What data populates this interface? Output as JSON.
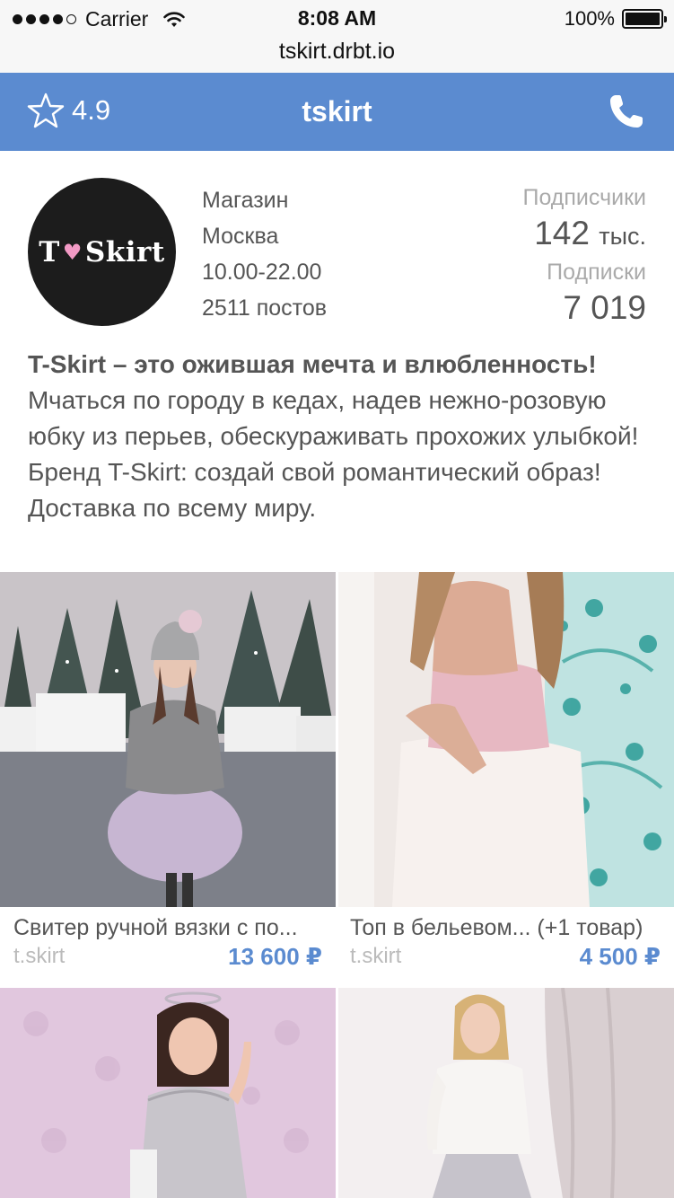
{
  "status": {
    "carrier": "Carrier",
    "time": "8:08 AM",
    "battery": "100%"
  },
  "browser": {
    "url": "tskirt.drbt.io"
  },
  "nav": {
    "rating": "4.9",
    "title": "tskirt"
  },
  "profile": {
    "avatar_text": "T♥Skirt",
    "category": "Магазин",
    "city": "Москва",
    "hours": "10.00-22.00",
    "posts": "2511 постов",
    "followers_label": "Подписчики",
    "followers_value": "142",
    "followers_unit": "тыс.",
    "following_label": "Подписки",
    "following_value": "7 019"
  },
  "description": {
    "bold": "T-Skirt – это ожившая мечта и влюбленность!",
    "text": " Мчаться по городу в кедах, надев нежно-розовую юбку из перьев, обескураживать прохожих улыбкой! Бренд T-Skirt: создай свой романтический образ! Доставка по всему миру."
  },
  "products": [
    {
      "name": "Свитер ручной вязки с по...",
      "shop": "t.skirt",
      "price": "13 600 ₽"
    },
    {
      "name": "Топ в бельевом... (+1 товар)",
      "shop": "t.skirt",
      "price": "4 500 ₽"
    },
    {
      "name": "",
      "shop": "",
      "price": ""
    },
    {
      "name": "",
      "shop": "",
      "price": ""
    }
  ],
  "colors": {
    "accent": "#5b8bd0",
    "status_bg": "#f7f7f7"
  }
}
